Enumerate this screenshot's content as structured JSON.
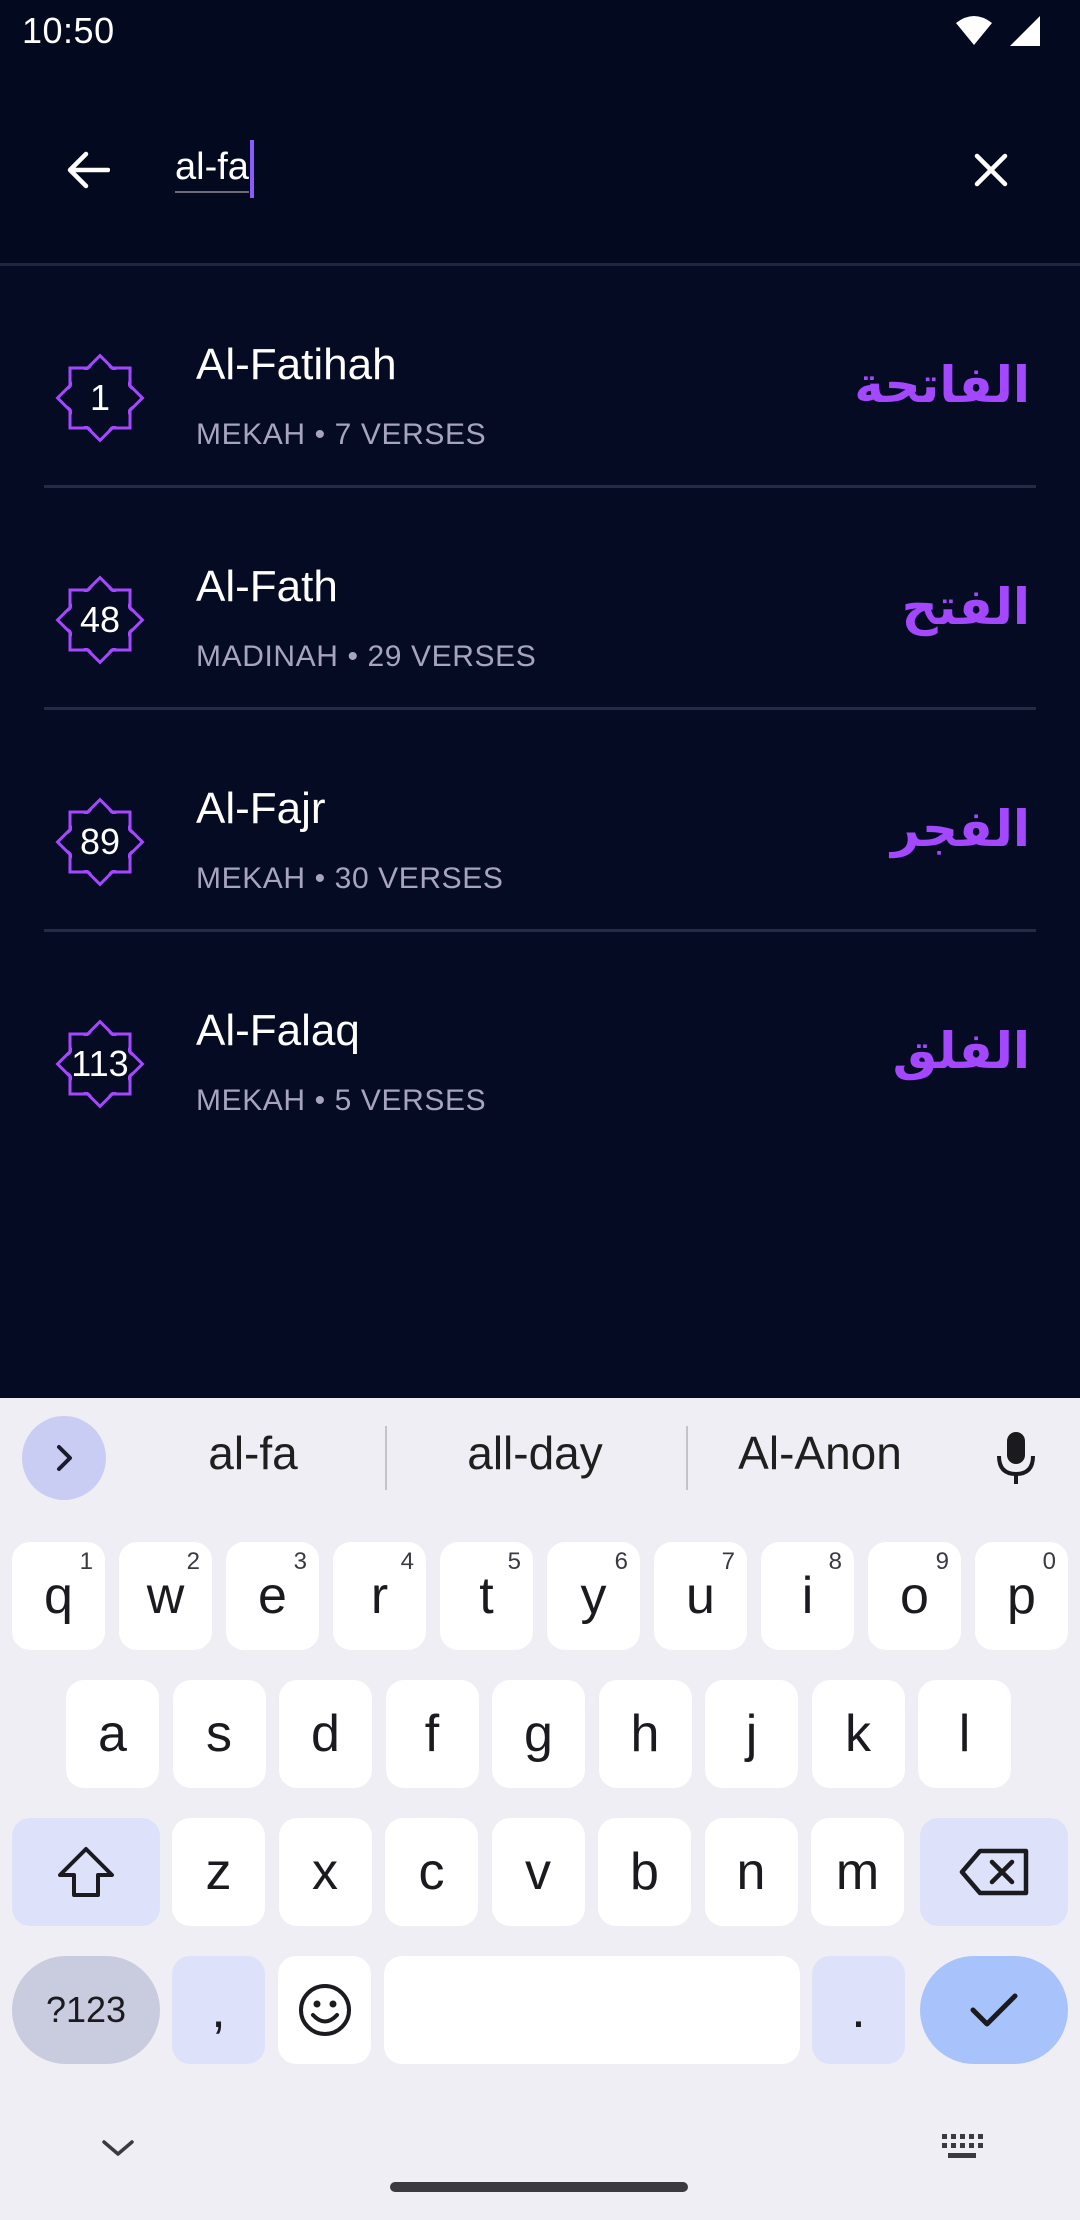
{
  "status": {
    "time": "10:50"
  },
  "search": {
    "value": "al-fa"
  },
  "surahs": [
    {
      "number": "1",
      "name": "Al-Fatihah",
      "meta": "MEKAH • 7 VERSES",
      "arabic": "الفاتحة"
    },
    {
      "number": "48",
      "name": "Al-Fath",
      "meta": "MADINAH • 29 VERSES",
      "arabic": "الفتح"
    },
    {
      "number": "89",
      "name": "Al-Fajr",
      "meta": "MEKAH • 30 VERSES",
      "arabic": "الفجر"
    },
    {
      "number": "113",
      "name": "Al-Falaq",
      "meta": "MEKAH • 5 VERSES",
      "arabic": "الفلق"
    }
  ],
  "keyboard": {
    "suggestions": [
      "al-fa",
      "all-day",
      "Al-Anon"
    ],
    "row1": [
      {
        "k": "q",
        "h": "1"
      },
      {
        "k": "w",
        "h": "2"
      },
      {
        "k": "e",
        "h": "3"
      },
      {
        "k": "r",
        "h": "4"
      },
      {
        "k": "t",
        "h": "5"
      },
      {
        "k": "y",
        "h": "6"
      },
      {
        "k": "u",
        "h": "7"
      },
      {
        "k": "i",
        "h": "8"
      },
      {
        "k": "o",
        "h": "9"
      },
      {
        "k": "p",
        "h": "0"
      }
    ],
    "row2": [
      "a",
      "s",
      "d",
      "f",
      "g",
      "h",
      "j",
      "k",
      "l"
    ],
    "row3": [
      "z",
      "x",
      "c",
      "v",
      "b",
      "n",
      "m"
    ],
    "symbols_label": "?123",
    "comma": ",",
    "period": "."
  },
  "colors": {
    "accent": "#a448ff",
    "background": "#040b22"
  }
}
